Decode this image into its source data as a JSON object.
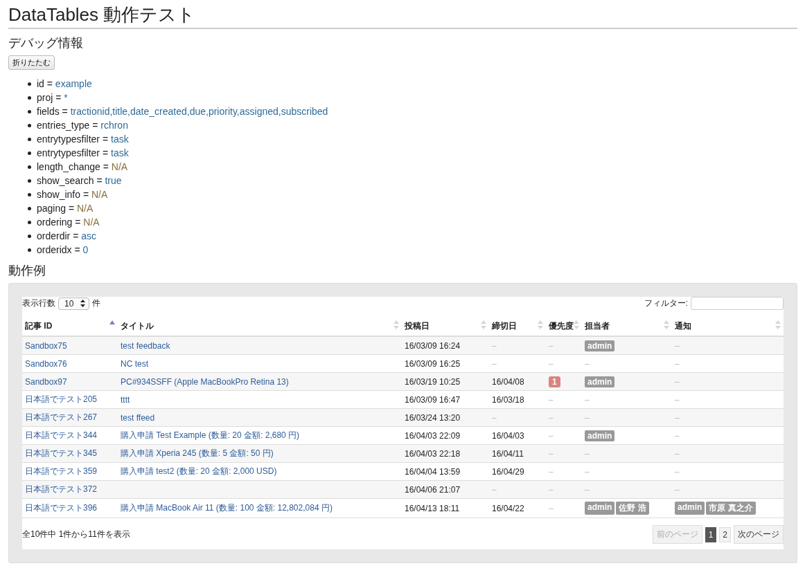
{
  "page_title": "DataTables 動作テスト",
  "debug": {
    "heading": "デバッグ情報",
    "toggle_button": "折りたたむ",
    "items": [
      {
        "key": "id",
        "eq": "=",
        "value": "example",
        "kind": "set"
      },
      {
        "key": "proj",
        "eq": "=",
        "value": "*",
        "kind": "set"
      },
      {
        "key": "fields",
        "eq": "=",
        "value": "tractionid,title,date_created,due,priority,assigned,subscribed",
        "kind": "set"
      },
      {
        "key": "entries_type",
        "eq": "=",
        "value": "rchron",
        "kind": "set"
      },
      {
        "key": "entrytypesfilter",
        "eq": "=",
        "value": "task",
        "kind": "set"
      },
      {
        "key": "entrytypesfilter",
        "eq": "=",
        "value": "task",
        "kind": "set"
      },
      {
        "key": "length_change",
        "eq": "=",
        "value": "N/A",
        "kind": "missing"
      },
      {
        "key": "show_search",
        "eq": "=",
        "value": "true",
        "kind": "set"
      },
      {
        "key": "show_info",
        "eq": "=",
        "value": "N/A",
        "kind": "missing"
      },
      {
        "key": "paging",
        "eq": "=",
        "value": "N/A",
        "kind": "missing"
      },
      {
        "key": "ordering",
        "eq": "=",
        "value": "N/A",
        "kind": "missing"
      },
      {
        "key": "orderdir",
        "eq": "=",
        "value": "asc",
        "kind": "set"
      },
      {
        "key": "orderidx",
        "eq": "=",
        "value": "0",
        "kind": "set"
      }
    ]
  },
  "example": {
    "heading": "動作例",
    "length": {
      "label": "表示行数",
      "value": "10",
      "unit": "件"
    },
    "filter": {
      "label": "フィルター:"
    },
    "columns": [
      {
        "label": "記事 ID",
        "sorted": true
      },
      {
        "label": "タイトル",
        "sorted": false
      },
      {
        "label": "投稿日",
        "sorted": false
      },
      {
        "label": "締切日",
        "sorted": false
      },
      {
        "label": "優先度",
        "sorted": false
      },
      {
        "label": "担当者",
        "sorted": false
      },
      {
        "label": "通知",
        "sorted": false
      }
    ],
    "rows": [
      {
        "id": "Sandbox75",
        "title": "test feedback",
        "created": "16/03/09 16:24",
        "due": {
          "kind": "dash",
          "text": "–"
        },
        "priority": {
          "kind": "dash",
          "text": "–"
        },
        "assigned": {
          "kind": "tags",
          "tags": [
            "admin"
          ]
        },
        "subscribed": {
          "kind": "dash",
          "text": "–"
        }
      },
      {
        "id": "Sandbox76",
        "title": "NC test",
        "created": "16/03/09 16:25",
        "due": {
          "kind": "dash",
          "text": "–"
        },
        "priority": {
          "kind": "dash",
          "text": "–"
        },
        "assigned": {
          "kind": "dash",
          "text": "–"
        },
        "subscribed": {
          "kind": "dash",
          "text": "–"
        }
      },
      {
        "id": "Sandbox97",
        "title": "PC#934SSFF (Apple MacBookPro Retina 13)",
        "created": "16/03/19 10:25",
        "due": {
          "kind": "date",
          "text": "16/04/08"
        },
        "priority": {
          "kind": "badge",
          "text": "1"
        },
        "assigned": {
          "kind": "tags",
          "tags": [
            "admin"
          ]
        },
        "subscribed": {
          "kind": "dash",
          "text": "–"
        }
      },
      {
        "id": "日本語でテスト205",
        "title": "tttt",
        "created": "16/03/09 16:47",
        "due": {
          "kind": "date",
          "text": "16/03/18"
        },
        "priority": {
          "kind": "dash",
          "text": "–"
        },
        "assigned": {
          "kind": "dash",
          "text": "–"
        },
        "subscribed": {
          "kind": "dash",
          "text": "–"
        }
      },
      {
        "id": "日本語でテスト267",
        "title": "test ffeed",
        "created": "16/03/24 13:20",
        "due": {
          "kind": "dash",
          "text": "–"
        },
        "priority": {
          "kind": "dash",
          "text": "–"
        },
        "assigned": {
          "kind": "dash",
          "text": "–"
        },
        "subscribed": {
          "kind": "dash",
          "text": "–"
        }
      },
      {
        "id": "日本語でテスト344",
        "title": "購入申請 Test Example (数量: 20 金額: 2,680 円)",
        "created": "16/04/03 22:09",
        "due": {
          "kind": "date",
          "text": "16/04/03"
        },
        "priority": {
          "kind": "dash",
          "text": "–"
        },
        "assigned": {
          "kind": "tags",
          "tags": [
            "admin"
          ]
        },
        "subscribed": {
          "kind": "dash",
          "text": "–"
        }
      },
      {
        "id": "日本語でテスト345",
        "title": "購入申請 Xperia 245 (数量: 5 金額: 50 円)",
        "created": "16/04/03 22:18",
        "due": {
          "kind": "date",
          "text": "16/04/11"
        },
        "priority": {
          "kind": "dash",
          "text": "–"
        },
        "assigned": {
          "kind": "dash",
          "text": "–"
        },
        "subscribed": {
          "kind": "dash",
          "text": "–"
        }
      },
      {
        "id": "日本語でテスト359",
        "title": "購入申請 test2 (数量: 20 金額: 2,000 USD)",
        "created": "16/04/04 13:59",
        "due": {
          "kind": "date",
          "text": "16/04/29"
        },
        "priority": {
          "kind": "dash",
          "text": "–"
        },
        "assigned": {
          "kind": "dash",
          "text": "–"
        },
        "subscribed": {
          "kind": "dash",
          "text": "–"
        }
      },
      {
        "id": "日本語でテスト372",
        "created": "16/04/06 21:07",
        "due": {
          "kind": "dash",
          "text": "–"
        },
        "priority": {
          "kind": "dash",
          "text": "–"
        },
        "assigned": {
          "kind": "dash",
          "text": "–"
        },
        "subscribed": {
          "kind": "dash",
          "text": "–"
        }
      },
      {
        "id": "日本語でテスト396",
        "title": "購入申請 MacBook Air 11 (数量: 100 金額: 12,802,084 円)",
        "created": "16/04/13 18:11",
        "due": {
          "kind": "date",
          "text": "16/04/22"
        },
        "priority": {
          "kind": "dash",
          "text": "–"
        },
        "assigned": {
          "kind": "tags",
          "tags": [
            "admin",
            "佐野 浩"
          ]
        },
        "subscribed": {
          "kind": "tags",
          "tags": [
            "admin",
            "市原 真之介"
          ]
        }
      }
    ],
    "info": "全10件中 1件から11件を表示",
    "pagination": {
      "previous": {
        "label": "前のページ",
        "disabled": true
      },
      "pages": [
        {
          "label": "1",
          "selected": true
        },
        {
          "label": "2",
          "selected": false
        }
      ],
      "next": {
        "label": "次のページ",
        "disabled": false
      }
    }
  }
}
